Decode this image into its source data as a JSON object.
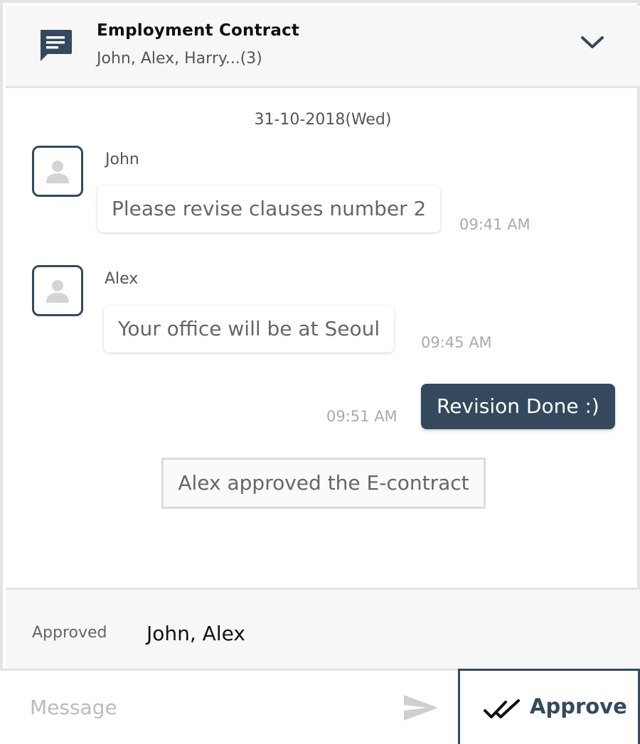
{
  "header": {
    "title": "Employment Contract",
    "participants": "John, Alex, Harry...(3)"
  },
  "chat": {
    "date": "31-10-2018(Wed)",
    "messages": [
      {
        "sender": "John",
        "text": "Please revise clauses number 2",
        "time": "09:41 AM"
      },
      {
        "sender": "Alex",
        "text": "Your office will be at Seoul",
        "time": "09:45 AM"
      }
    ],
    "own_message": {
      "text": "Revision Done :)",
      "time": "09:51 AM"
    },
    "system_note": "Alex approved the E-contract"
  },
  "approved": {
    "label": "Approved",
    "names": "John, Alex"
  },
  "composer": {
    "placeholder": "Message",
    "approve_label": "Approve"
  },
  "colors": {
    "accent": "#34495e",
    "header_bg": "#f7f7f7",
    "border": "#e2e2e2"
  }
}
